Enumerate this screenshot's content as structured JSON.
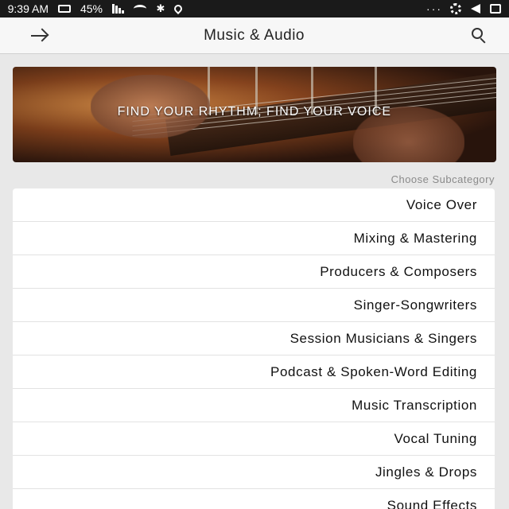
{
  "status_bar": {
    "time": "9:39 AM",
    "battery": "45%",
    "icons": [
      "image-icon",
      "send-icon",
      "fan-icon",
      "more-dots-icon",
      "location-icon",
      "bluetooth-icon",
      "wifi-icon",
      "signal-icon",
      "battery-icon"
    ],
    "more_dots": "···"
  },
  "header": {
    "title": "Music & Audio",
    "back_icon": "arrow-back-icon",
    "search_icon": "search-icon"
  },
  "banner": {
    "text": "FIND YOUR RHYTHM; FIND YOUR VOICE"
  },
  "section_label": "Choose Subcategory",
  "subcategories": [
    {
      "label": "Voice Over"
    },
    {
      "label": "Mixing & Mastering"
    },
    {
      "label": "Producers & Composers"
    },
    {
      "label": "Singer-Songwriters"
    },
    {
      "label": "Session Musicians & Singers"
    },
    {
      "label": "Podcast & Spoken-Word Editing"
    },
    {
      "label": "Music Transcription"
    },
    {
      "label": "Vocal Tuning"
    },
    {
      "label": "Jingles & Drops"
    },
    {
      "label": "Sound Effects"
    }
  ],
  "colors": {
    "status_bar_bg": "#1a1a1a",
    "header_bg": "#f7f7f7",
    "page_bg": "#e8e8e8",
    "list_bg": "#ffffff"
  }
}
